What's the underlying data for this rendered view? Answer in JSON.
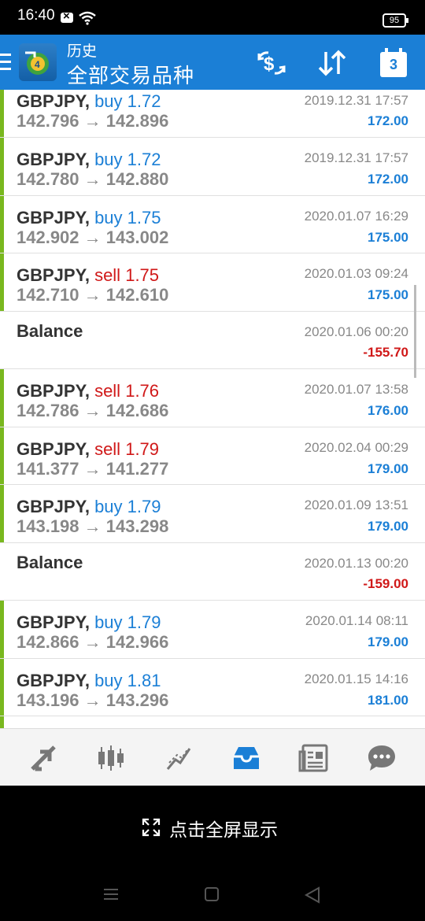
{
  "status_bar": {
    "time": "16:40",
    "battery": "95"
  },
  "header": {
    "title": "历史",
    "subtitle": "全部交易品种"
  },
  "trades": [
    {
      "kind": "trade",
      "symbol": "GBPJPY,",
      "action": "buy",
      "lots": "1.72",
      "open": "142.796",
      "arrow": "→",
      "close": "142.896",
      "date": "2019.12.31 17:57",
      "profit": "172.00"
    },
    {
      "kind": "trade",
      "symbol": "GBPJPY,",
      "action": "buy",
      "lots": "1.72",
      "open": "142.780",
      "arrow": "→",
      "close": "142.880",
      "date": "2019.12.31 17:57",
      "profit": "172.00"
    },
    {
      "kind": "trade",
      "symbol": "GBPJPY,",
      "action": "buy",
      "lots": "1.75",
      "open": "142.902",
      "arrow": "→",
      "close": "143.002",
      "date": "2020.01.07 16:29",
      "profit": "175.00"
    },
    {
      "kind": "trade",
      "symbol": "GBPJPY,",
      "action": "sell",
      "lots": "1.75",
      "open": "142.710",
      "arrow": "→",
      "close": "142.610",
      "date": "2020.01.03 09:24",
      "profit": "175.00"
    },
    {
      "kind": "balance",
      "label": "Balance",
      "date": "2020.01.06 00:20",
      "amount": "-155.70"
    },
    {
      "kind": "trade",
      "symbol": "GBPJPY,",
      "action": "sell",
      "lots": "1.76",
      "open": "142.786",
      "arrow": "→",
      "close": "142.686",
      "date": "2020.01.07 13:58",
      "profit": "176.00"
    },
    {
      "kind": "trade",
      "symbol": "GBPJPY,",
      "action": "sell",
      "lots": "1.79",
      "open": "141.377",
      "arrow": "→",
      "close": "141.277",
      "date": "2020.02.04 00:29",
      "profit": "179.00"
    },
    {
      "kind": "trade",
      "symbol": "GBPJPY,",
      "action": "buy",
      "lots": "1.79",
      "open": "143.198",
      "arrow": "→",
      "close": "143.298",
      "date": "2020.01.09 13:51",
      "profit": "179.00"
    },
    {
      "kind": "balance",
      "label": "Balance",
      "date": "2020.01.13 00:20",
      "amount": "-159.00"
    },
    {
      "kind": "trade",
      "symbol": "GBPJPY,",
      "action": "buy",
      "lots": "1.79",
      "open": "142.866",
      "arrow": "→",
      "close": "142.966",
      "date": "2020.01.14 08:11",
      "profit": "179.00"
    },
    {
      "kind": "trade",
      "symbol": "GBPJPY,",
      "action": "buy",
      "lots": "1.81",
      "open": "143.196",
      "arrow": "→",
      "close": "143.296",
      "date": "2020.01.15 14:16",
      "profit": "181.00"
    }
  ],
  "tabs": [
    {
      "icon": "quotes-icon"
    },
    {
      "icon": "chart-candles-icon"
    },
    {
      "icon": "trade-icon"
    },
    {
      "icon": "history-inbox-icon",
      "active": true
    },
    {
      "icon": "news-icon"
    },
    {
      "icon": "chat-icon"
    }
  ],
  "fullscreen_hint": "点击全屏显示",
  "colors": {
    "accent": "#1b7fd6",
    "sell": "#d01818",
    "buy": "#1b7fd6",
    "row_bar": "#79b81f"
  }
}
